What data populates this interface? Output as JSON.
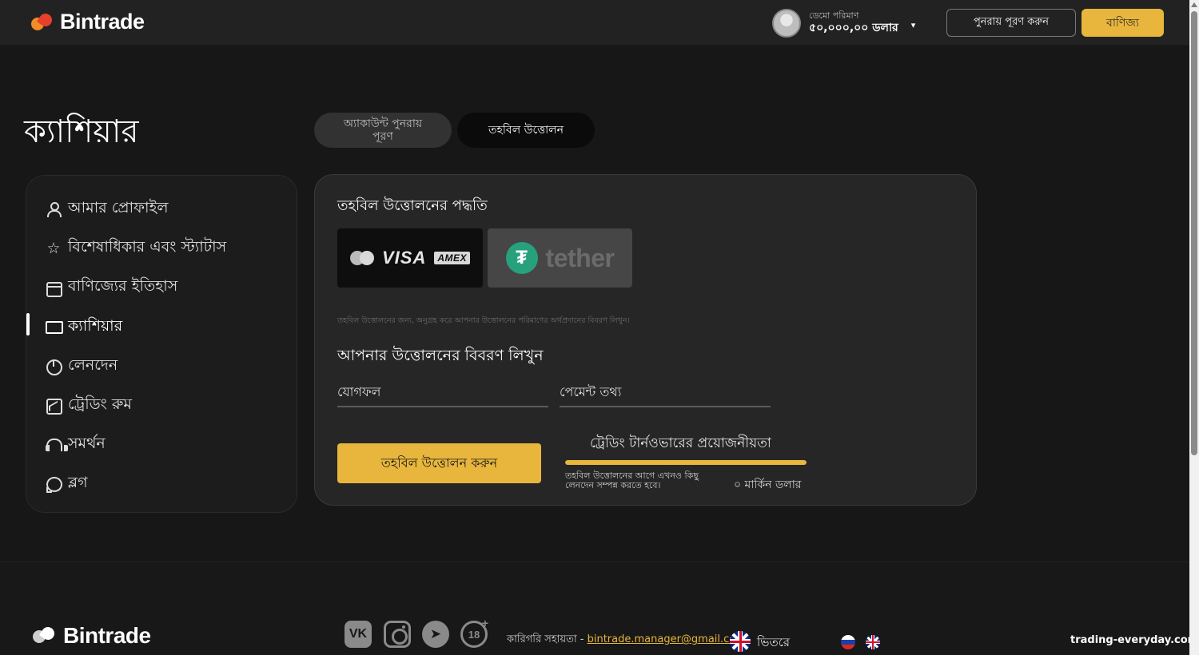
{
  "header": {
    "brand": "Bintrade",
    "account_label": "ডেমো পরিমাণ",
    "account_value": "৫০,০০০,০০ ডলার",
    "caret": "▾",
    "deposit_button": "পুনরায় পূরণ করুন",
    "trade_button": "বাণিজ্য"
  },
  "page": {
    "title": "ক্যাশিয়ার"
  },
  "tabs": [
    {
      "label": "অ্যাকাউন্ট পুনরায় পূরণ",
      "active": false
    },
    {
      "label": "তহবিল উত্তোলন",
      "active": true
    }
  ],
  "sidebar": {
    "items": [
      {
        "label": "আমার প্রোফাইল",
        "icon": "user-icon"
      },
      {
        "label": "বিশেষাধিকার এবং স্ট্যাটাস",
        "icon": "star-icon"
      },
      {
        "label": "বাণিজ্যের ইতিহাস",
        "icon": "calendar-icon"
      },
      {
        "label": "ক্যাশিয়ার",
        "icon": "monitor-icon",
        "active": true
      },
      {
        "label": "লেনদেন",
        "icon": "pie-chart-icon"
      },
      {
        "label": "ট্রেডিং রুম",
        "icon": "line-chart-icon"
      },
      {
        "label": "সমর্থন",
        "icon": "headphones-icon"
      },
      {
        "label": "ব্লগ",
        "icon": "chat-bubble-icon"
      }
    ]
  },
  "withdraw": {
    "methods_title": "তহবিল উত্তোলনের পদ্ধতি",
    "methods": [
      {
        "name": "card",
        "visa": "VISA",
        "amex": "AMEX",
        "selected": true
      },
      {
        "name": "tether",
        "label": "tether",
        "symbol": "₮",
        "selected": false
      }
    ],
    "note": "তহবিল উত্তোলনের জন্য, অনুগ্রহ করে আপনার উত্তোলনের পরিমাণের অর্থপ্রদানের বিবরণ লিখুন।",
    "details_title": "আপনার উত্তোলনের বিবরণ লিখুন",
    "amount_placeholder": "যোগফল",
    "payment_placeholder": "পেমেন্ট তথ্য",
    "submit_label": "তহবিল উত্তোলন করুন",
    "turnover": {
      "title": "ট্রেডিং টার্নওভারের প্রয়োজনীয়তা",
      "progress": 1.0,
      "description": "তহবিল উত্তোলনের আগে এখনও কিছু লেনদেন সম্পন্ন করতে হবে।",
      "amount": "০ মার্কিন ডলার"
    }
  },
  "footer": {
    "brand": "Bintrade",
    "social": [
      "vk-icon",
      "instagram-icon",
      "telegram-icon",
      "age-18-icon"
    ],
    "vk_text": "VK",
    "age_text": "18",
    "age_plus": "+",
    "support_prefix": "কারিগরি সহায়তা - ",
    "support_email": "bintrade.manager@gmail.com",
    "language": "ভিতরে"
  },
  "watermark": "trading-everyday.com",
  "colors": {
    "accent": "#e8b63c",
    "background": "#171717",
    "panel": "#262626",
    "tether_green": "#27a17c"
  }
}
